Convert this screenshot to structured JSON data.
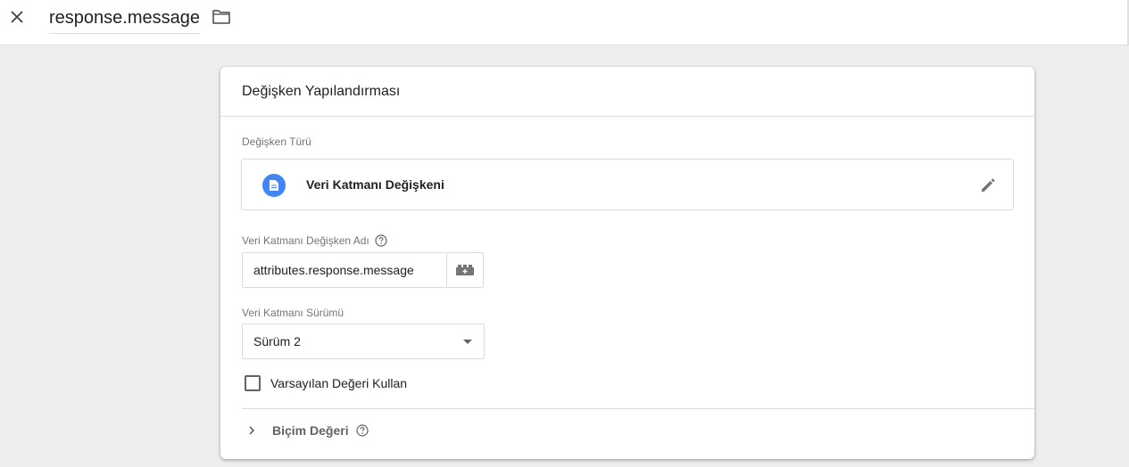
{
  "header": {
    "title": "response.message",
    "close_icon": "close-icon",
    "folder_icon": "folder-icon"
  },
  "card": {
    "title": "Değişken Yapılandırması",
    "variable_type": {
      "label": "Değişken Türü",
      "value": "Veri Katmanı Değişkeni",
      "icon": "document-icon",
      "edit_icon": "pencil-icon"
    },
    "dlv_name": {
      "label": "Veri Katmanı Değişken Adı",
      "value": "attributes.response.message",
      "help_icon": "help-icon",
      "picker_icon": "variable-picker-icon"
    },
    "dlv_version": {
      "label": "Veri Katmanı Sürümü",
      "selected": "Sürüm 2"
    },
    "default_value": {
      "label": "Varsayılan Değeri Kullan",
      "checked": false
    },
    "format_value": {
      "label": "Biçim Değeri",
      "expanded": false
    }
  },
  "colors": {
    "accent": "#4285f4",
    "background": "#eeeeee",
    "border": "#dadce0"
  }
}
